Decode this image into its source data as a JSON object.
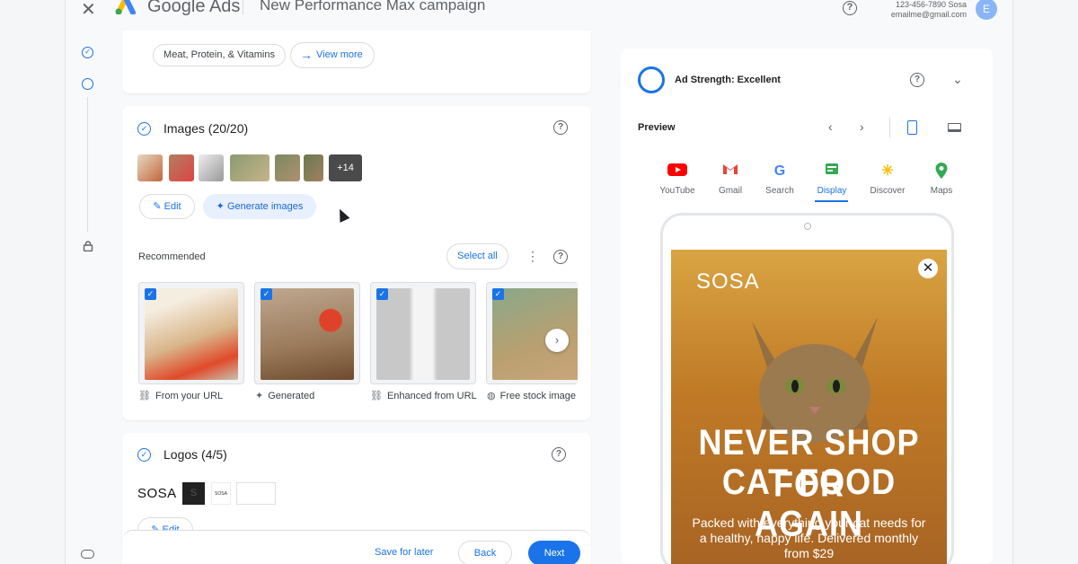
{
  "header": {
    "brand": "Google Ads",
    "campaign_title": "New Performance Max campaign",
    "account_id": "123-456-7890 Sosa",
    "account_email": "emailme@gmail.com",
    "avatar_letter": "E"
  },
  "top_section": {
    "chip_label": "Meat, Protein, & Vitamins",
    "view_more_label": "View more"
  },
  "images_section": {
    "title": "Images (20/20)",
    "more_count": "+14",
    "edit_label": "Edit",
    "generate_label": "Generate images",
    "recommended_label": "Recommended",
    "select_all_label": "Select all",
    "recommended": [
      {
        "source": "From your URL",
        "source_icon": "link-icon"
      },
      {
        "source": "Generated",
        "source_icon": "sparkle-icon"
      },
      {
        "source": "Enhanced from URL",
        "source_icon": "enhance-link-icon"
      },
      {
        "source": "Free stock image",
        "source_icon": "globe-icon"
      }
    ]
  },
  "logos_section": {
    "title": "Logos (4/5)",
    "logo_text": "SOSA",
    "small_logo_text": "SOSA",
    "edit_label": "Edit"
  },
  "footer": {
    "save_label": "Save for later",
    "back_label": "Back",
    "next_label": "Next"
  },
  "preview_panel": {
    "strength_label": "Ad Strength: Excellent",
    "preview_label": "Preview",
    "tabs": [
      {
        "label": "YouTube",
        "color": "#ff0000"
      },
      {
        "label": "Gmail",
        "color": "#ea4335"
      },
      {
        "label": "Search",
        "color": "#4285f4"
      },
      {
        "label": "Display",
        "color": "#1a73e8"
      },
      {
        "label": "Discover",
        "color": "#fbbc04"
      },
      {
        "label": "Maps",
        "color": "#34a853"
      }
    ],
    "active_tab": "Display",
    "ad": {
      "brand": "SOSA",
      "headline_line1": "NEVER SHOP FOR",
      "headline_line2": "CAT FOOD AGAIN",
      "body": "Packed with everything your cat needs for a healthy, happy life. Delivered monthly from $29"
    }
  }
}
